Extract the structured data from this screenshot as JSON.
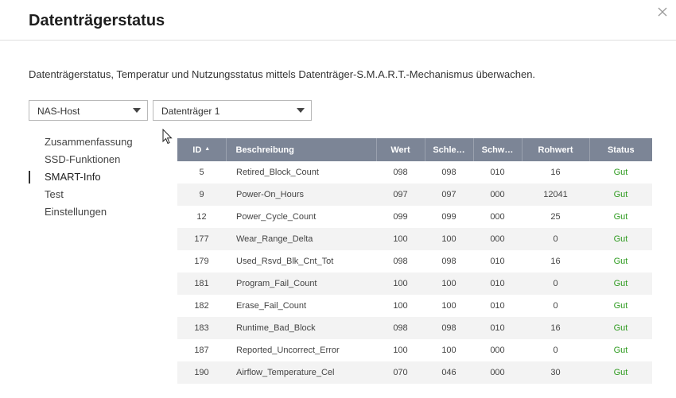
{
  "dialog": {
    "title": "Datenträgerstatus",
    "description": "Datenträgerstatus, Temperatur und Nutzungsstatus mittels Datenträger-S.M.A.R.T.-Mechanismus überwachen.",
    "close_icon": "close-icon"
  },
  "selects": {
    "host": "NAS-Host",
    "disk": "Datenträger 1"
  },
  "nav": {
    "items": [
      {
        "label": "Zusammenfassung",
        "active": false
      },
      {
        "label": "SSD-Funktionen",
        "active": false
      },
      {
        "label": "SMART-Info",
        "active": true
      },
      {
        "label": "Test",
        "active": false
      },
      {
        "label": "Einstellungen",
        "active": false
      }
    ]
  },
  "table": {
    "headers": [
      "ID",
      "Beschreibung",
      "Wert",
      "Schle…",
      "Schw…",
      "Rohwert",
      "Status"
    ],
    "rows": [
      [
        "5",
        "Retired_Block_Count",
        "098",
        "098",
        "010",
        "16",
        "Gut"
      ],
      [
        "9",
        "Power-On_Hours",
        "097",
        "097",
        "000",
        "12041",
        "Gut"
      ],
      [
        "12",
        "Power_Cycle_Count",
        "099",
        "099",
        "000",
        "25",
        "Gut"
      ],
      [
        "177",
        "Wear_Range_Delta",
        "100",
        "100",
        "000",
        "0",
        "Gut"
      ],
      [
        "179",
        "Used_Rsvd_Blk_Cnt_Tot",
        "098",
        "098",
        "010",
        "16",
        "Gut"
      ],
      [
        "181",
        "Program_Fail_Count",
        "100",
        "100",
        "010",
        "0",
        "Gut"
      ],
      [
        "182",
        "Erase_Fail_Count",
        "100",
        "100",
        "010",
        "0",
        "Gut"
      ],
      [
        "183",
        "Runtime_Bad_Block",
        "098",
        "098",
        "010",
        "16",
        "Gut"
      ],
      [
        "187",
        "Reported_Uncorrect_Error",
        "100",
        "100",
        "000",
        "0",
        "Gut"
      ],
      [
        "190",
        "Airflow_Temperature_Cel",
        "070",
        "046",
        "000",
        "30",
        "Gut"
      ]
    ]
  },
  "colors": {
    "header_bg": "#7c8596",
    "status_ok": "#2d9a1e",
    "row_alt": "#f3f3f3"
  }
}
